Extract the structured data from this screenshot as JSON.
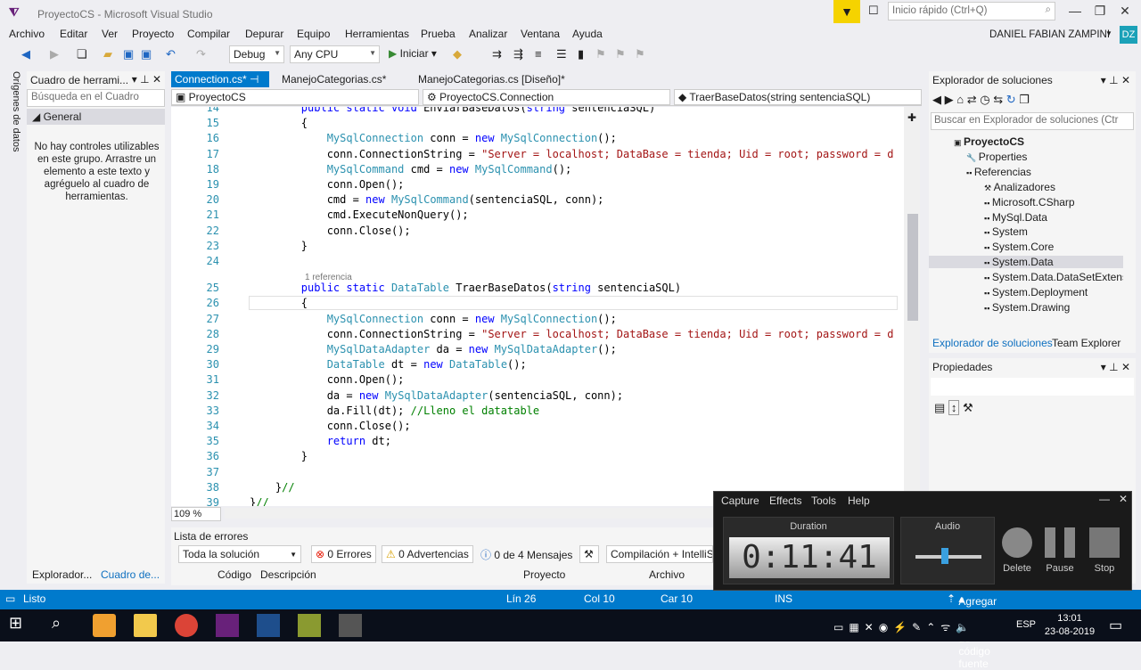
{
  "window": {
    "title": "ProyectoCS - Microsoft Visual Studio",
    "quick_launch_placeholder": "Inicio rápido (Ctrl+Q)",
    "user": "DANIEL FABIAN ZAMPINI",
    "user_initials": "DZ"
  },
  "menu": [
    "Archivo",
    "Editar",
    "Ver",
    "Proyecto",
    "Compilar",
    "Depurar",
    "Equipo",
    "Herramientas",
    "Prueba",
    "Analizar",
    "Ventana",
    "Ayuda"
  ],
  "toolbar": {
    "config": "Debug",
    "platform": "Any CPU",
    "start": "Iniciar"
  },
  "left_vertical_tab": "Orígenes de datos",
  "toolbox": {
    "title": "Cuadro de herrami...",
    "search_placeholder": "Búsqueda en el Cuadro",
    "group": "General",
    "empty_text": "No hay controles utilizables en este grupo. Arrastre un elemento a este texto y agréguelo al cuadro de herramientas.",
    "bottom_tabs": [
      "Explorador...",
      "Cuadro de..."
    ]
  },
  "doc_tabs": [
    "Connection.cs*",
    "ManejoCategorias.cs*",
    "ManejoCategorias.cs [Diseño]*"
  ],
  "nav": {
    "project": "ProyectoCS",
    "class": "ProyectoCS.Connection",
    "member": "TraerBaseDatos(string sentenciaSQL)"
  },
  "code": {
    "lines": [
      {
        "n": "14",
        "html": "        <span class='kw'>public static void</span> EnviarBaseDatos(<span class='kw'>string</span> sentenciaSQL)"
      },
      {
        "n": "15",
        "html": "        {"
      },
      {
        "n": "16",
        "html": "            <span class='ty'>MySqlConnection</span> conn = <span class='kw'>new</span> <span class='ty'>MySqlConnection</span>();"
      },
      {
        "n": "17",
        "html": "            conn.ConnectionString = <span class='st'>\"Server = localhost; DataBase = tienda; Uid = root; password = d</span>"
      },
      {
        "n": "18",
        "html": "            <span class='ty'>MySqlCommand</span> cmd = <span class='kw'>new</span> <span class='ty'>MySqlCommand</span>();"
      },
      {
        "n": "19",
        "html": "            conn.Open();"
      },
      {
        "n": "20",
        "html": "            cmd = <span class='kw'>new</span> <span class='ty'>MySqlCommand</span>(sentenciaSQL, conn);"
      },
      {
        "n": "21",
        "html": "            cmd.ExecuteNonQuery();"
      },
      {
        "n": "22",
        "html": "            conn.Close();"
      },
      {
        "n": "23",
        "html": "        }"
      },
      {
        "n": "24",
        "html": ""
      },
      {
        "n": "25",
        "html": "        <span class='kw'>public static</span> <span class='ty'>DataTable</span> TraerBaseDatos(<span class='kw'>string</span> sentenciaSQL)"
      },
      {
        "n": "26",
        "html": "        {"
      },
      {
        "n": "27",
        "html": "            <span class='ty'>MySqlConnection</span> conn = <span class='kw'>new</span> <span class='ty'>MySqlConnection</span>();"
      },
      {
        "n": "28",
        "html": "            conn.ConnectionString = <span class='st'>\"Server = localhost; DataBase = tienda; Uid = root; password = d</span>"
      },
      {
        "n": "29",
        "html": "            <span class='ty'>MySqlDataAdapter</span> da = <span class='kw'>new</span> <span class='ty'>MySqlDataAdapter</span>();"
      },
      {
        "n": "30",
        "html": "            <span class='ty'>DataTable</span> dt = <span class='kw'>new</span> <span class='ty'>DataTable</span>();"
      },
      {
        "n": "31",
        "html": "            conn.Open();"
      },
      {
        "n": "32",
        "html": "            da = <span class='kw'>new</span> <span class='ty'>MySqlDataAdapter</span>(sentenciaSQL, conn);"
      },
      {
        "n": "33",
        "html": "            da.Fill(dt); <span class='cm'>//Lleno el datatable</span>"
      },
      {
        "n": "34",
        "html": "            conn.Close();"
      },
      {
        "n": "35",
        "html": "            <span class='kw'>return</span> dt;"
      },
      {
        "n": "36",
        "html": "        }"
      },
      {
        "n": "37",
        "html": ""
      },
      {
        "n": "38",
        "html": "    }<span class='cm'>//</span>"
      },
      {
        "n": "39",
        "html": "}<span class='cm'>//</span>"
      }
    ],
    "reference_label": "1 referencia"
  },
  "zoom": "109 %",
  "error_list": {
    "title": "Lista de errores",
    "scope": "Toda la solución",
    "errors": "0 Errores",
    "warnings": "0 Advertencias",
    "messages": "0 de 4 Mensajes",
    "build": "Compilación + IntelliSe",
    "columns": [
      "Código",
      "Descripción",
      "Proyecto",
      "Archivo"
    ]
  },
  "solution_explorer": {
    "title": "Explorador de soluciones",
    "search_placeholder": "Buscar en Explorador de soluciones (Ctr",
    "items": [
      {
        "label": "ProyectoCS",
        "bold": true
      },
      {
        "label": "Properties"
      },
      {
        "label": "Referencias"
      },
      {
        "label": "Analizadores"
      },
      {
        "label": "Microsoft.CSharp"
      },
      {
        "label": "MySql.Data"
      },
      {
        "label": "System"
      },
      {
        "label": "System.Core"
      },
      {
        "label": "System.Data",
        "selected": true
      },
      {
        "label": "System.Data.DataSetExtensi"
      },
      {
        "label": "System.Deployment"
      },
      {
        "label": "System.Drawing"
      }
    ],
    "tabs": [
      "Explorador de soluciones",
      "Team Explorer"
    ]
  },
  "properties": {
    "title": "Propiedades"
  },
  "status": {
    "state": "Listo",
    "line": "Lín 26",
    "col": "Col 10",
    "car": "Car 10",
    "ins": "INS",
    "source_control": "Agregar al control de código fuente"
  },
  "capture": {
    "menu": [
      "Capture",
      "Effects",
      "Tools",
      "Help"
    ],
    "duration_label": "Duration",
    "duration": "0:11:41",
    "audio_label": "Audio",
    "audio_level": 0.45,
    "buttons": [
      "Delete",
      "Pause",
      "Stop"
    ]
  },
  "taskbar": {
    "lang": "ESP",
    "time": "13:01",
    "date": "23-08-2019"
  }
}
